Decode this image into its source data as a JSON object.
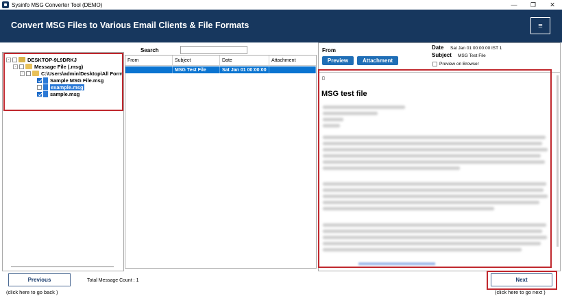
{
  "window": {
    "title": "Sysinfo MSG Converter Tool (DEMO)",
    "controls": [
      "—",
      "❐",
      "✕"
    ]
  },
  "header": {
    "title": "Convert MSG Files to Various Email Clients & File Formats",
    "menu_icon": "≡"
  },
  "tree": {
    "root": "DESKTOP-9L9DRKJ",
    "group": "Message File (.msg)",
    "path": "C:\\Users\\admin\\Desktop\\All Form",
    "files": [
      "Sample MSG File.msg",
      "example.msg",
      "sample.msg"
    ],
    "expander_symbol": "-"
  },
  "search": {
    "label": "Search",
    "value": ""
  },
  "list": {
    "columns": [
      "From",
      "Subject",
      "Date",
      "Attachment"
    ],
    "rows": [
      {
        "from": "",
        "subject": "MSG Test File",
        "date": "Sat Jan 01 00:00:00",
        "attachment": ""
      }
    ]
  },
  "preview": {
    "from_label": "From",
    "preview_button": "Preview",
    "attachment_button": "Attachment",
    "date_label": "Date",
    "date_value": "Sat Jan 01 00:00:00 IST 1",
    "subject_label": "Subject",
    "subject_value": "MSG Test File",
    "preview_on_browser": "Preview on Browser",
    "body_glyph": "▯",
    "body_title": "MSG test file"
  },
  "footer": {
    "previous_label": "Previous",
    "previous_hint": "(click here to  go back )",
    "count_text": "Total Message Count : 1",
    "next_label": "Next",
    "next_hint": "(click here to  go next )"
  },
  "colors": {
    "header_bg": "#17375e",
    "accent_blue": "#1f6eb6",
    "highlight_red": "#c0272d",
    "selection_blue": "#0a74d1"
  }
}
